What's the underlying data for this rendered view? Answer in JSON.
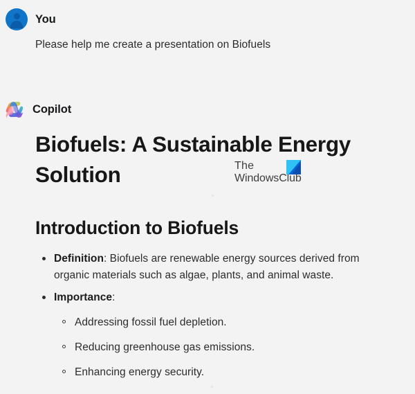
{
  "app": {
    "background_color": "#f3f3f3",
    "accent_color": "#1074c9"
  },
  "messages": [
    {
      "role": "user",
      "sender_label": "You",
      "avatar_icon": "person-avatar-icon",
      "text": "Please help me create a presentation on Biofuels"
    },
    {
      "role": "assistant",
      "sender_label": "Copilot",
      "avatar_icon": "copilot-logo-icon"
    }
  ],
  "answer": {
    "title": "Biofuels: A Sustainable Energy Solution",
    "section_heading": "Introduction to Biofuels",
    "bullets": [
      {
        "label": "Definition",
        "separator": ":",
        "text": " Biofuels are renewable energy sources derived from organic materials such as algae, plants, and animal waste."
      },
      {
        "label": "Importance",
        "separator": ":",
        "text": "",
        "sub_bullets": [
          "Addressing fossil fuel depletion.",
          "Reducing greenhouse gas emissions.",
          "Enhancing energy security."
        ]
      }
    ]
  },
  "watermark": {
    "line1": "The",
    "line2": "WindowsClub",
    "logo_icon": "windowsclub-logo-icon",
    "logo_colors": {
      "cyan": "#2fc3f5",
      "blue": "#0b63d6",
      "dark": "#0a4fae"
    }
  }
}
